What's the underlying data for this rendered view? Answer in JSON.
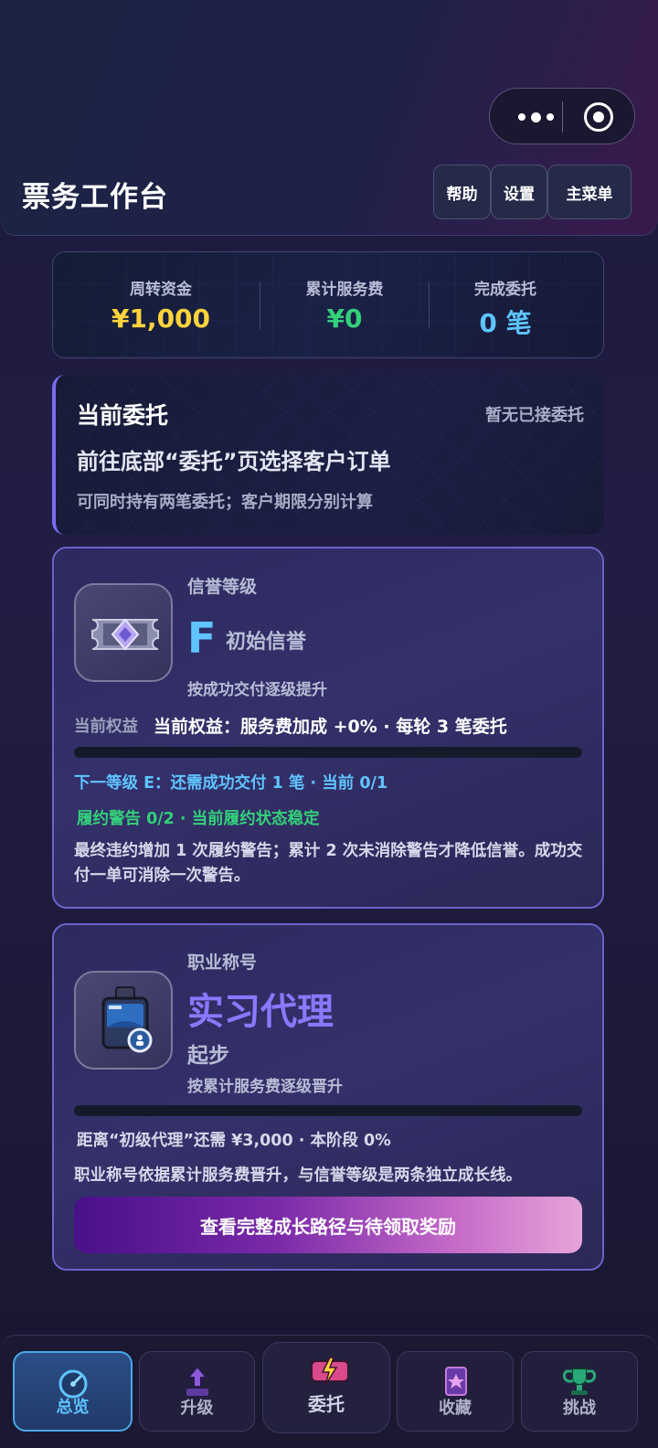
{
  "header": {
    "title": "票务工作台",
    "buttons": {
      "help": "帮助",
      "settings": "设置",
      "menu": "主菜单"
    }
  },
  "stats": [
    {
      "label": "周转资金",
      "value": "¥1,000",
      "color": "#ffd43b"
    },
    {
      "label": "累计服务费",
      "value": "¥0",
      "color": "#33d17a"
    },
    {
      "label": "完成委托",
      "value": "0 笔",
      "color": "#5fc4ff"
    }
  ],
  "current_commission": {
    "title": "当前委托",
    "status": "暂无已接委托",
    "headline": "前往底部“委托”页选择客户订单",
    "note": "可同时持有两笔委托；客户期限分别计算"
  },
  "credit": {
    "label": "信誉等级",
    "grade": "F",
    "grade_name": "初始信誉",
    "subtitle": "按成功交付逐级提升",
    "benefit_label": "当前权益",
    "benefit_text": "当前权益：服务费加成 +0% · 每轮 3 笔委托",
    "progress": 0,
    "next_level": "下一等级 E：还需成功交付 1 笔 · 当前 0/1",
    "warning": "履约警告 0/2 · 当前履约状态稳定",
    "rule": "最终违约增加 1 次履约警告；累计 2 次未消除警告才降低信誉。成功交付一单可消除一次警告。"
  },
  "career": {
    "label": "职业称号",
    "title": "实习代理",
    "stage": "起步",
    "subtitle": "按累计服务费逐级晋升",
    "progress": 0,
    "next": "距离“初级代理”还需 ¥3,000 · 本阶段 0%",
    "rule": "职业称号依据累计服务费晋升，与信誉等级是两条独立成长线。",
    "button": "查看完整成长路径与待领取奖励"
  },
  "tabs": [
    {
      "label": "总览",
      "icon": "speedometer-icon",
      "active": true
    },
    {
      "label": "升级",
      "icon": "upgrade-arrow-icon",
      "active": false
    },
    {
      "label": "委托",
      "icon": "ticket-bolt-icon",
      "active": false
    },
    {
      "label": "收藏",
      "icon": "collection-card-icon",
      "active": false
    },
    {
      "label": "挑战",
      "icon": "trophy-icon",
      "active": false
    }
  ],
  "colors": {
    "accent_blue": "#5fc4ff",
    "accent_purple": "#7b6cf0",
    "green": "#33d17a",
    "gold": "#ffd43b"
  }
}
